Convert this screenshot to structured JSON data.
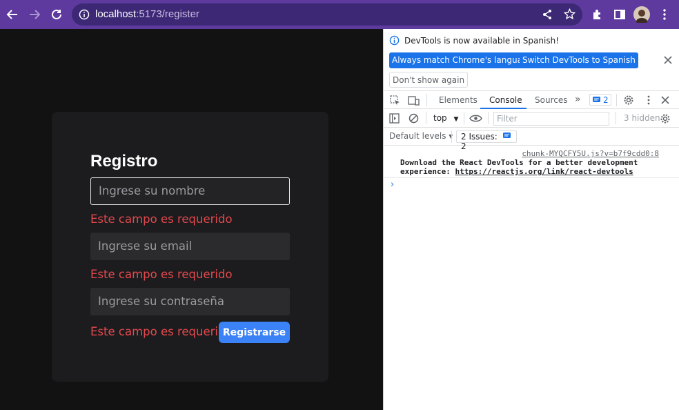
{
  "browser": {
    "url_host": "localhost",
    "url_path": ":5173/register"
  },
  "form": {
    "title": "Registro",
    "name_placeholder": "Ingrese su nombre",
    "email_placeholder": "Ingrese su email",
    "password_placeholder": "Ingrese su contraseña",
    "error_name": "Este campo es requerido",
    "error_email": "Este campo es requerido",
    "error_password": "Este campo es requerido",
    "submit_label": "Registrarse"
  },
  "devtools": {
    "notice": "DevTools is now available in Spanish!",
    "btn_match": "Always match Chrome's language",
    "btn_switch": "Switch DevTools to Spanish",
    "btn_dont_show": "Don't show again",
    "tabs": [
      "Elements",
      "Console",
      "Sources"
    ],
    "issues_badge": "2",
    "context": "top",
    "filter_placeholder": "Filter",
    "hidden_count": "3 hidden",
    "levels": "Default levels ▾",
    "issues_label": "2 Issues:",
    "issues_count": "2",
    "log_source": "chunk-MYQCFY5U.js?v=b7f9cdd0:8",
    "log_text_1": "Download the React DevTools for a better development",
    "log_text_2": "experience: ",
    "log_link": "https://reactjs.org/link/react-devtools",
    "prompt": "›"
  },
  "colors": {
    "toolbar": "#5e3a9f",
    "accent": "#3b82f6",
    "error": "#e5484d",
    "devtools_blue": "#1a73e8"
  }
}
